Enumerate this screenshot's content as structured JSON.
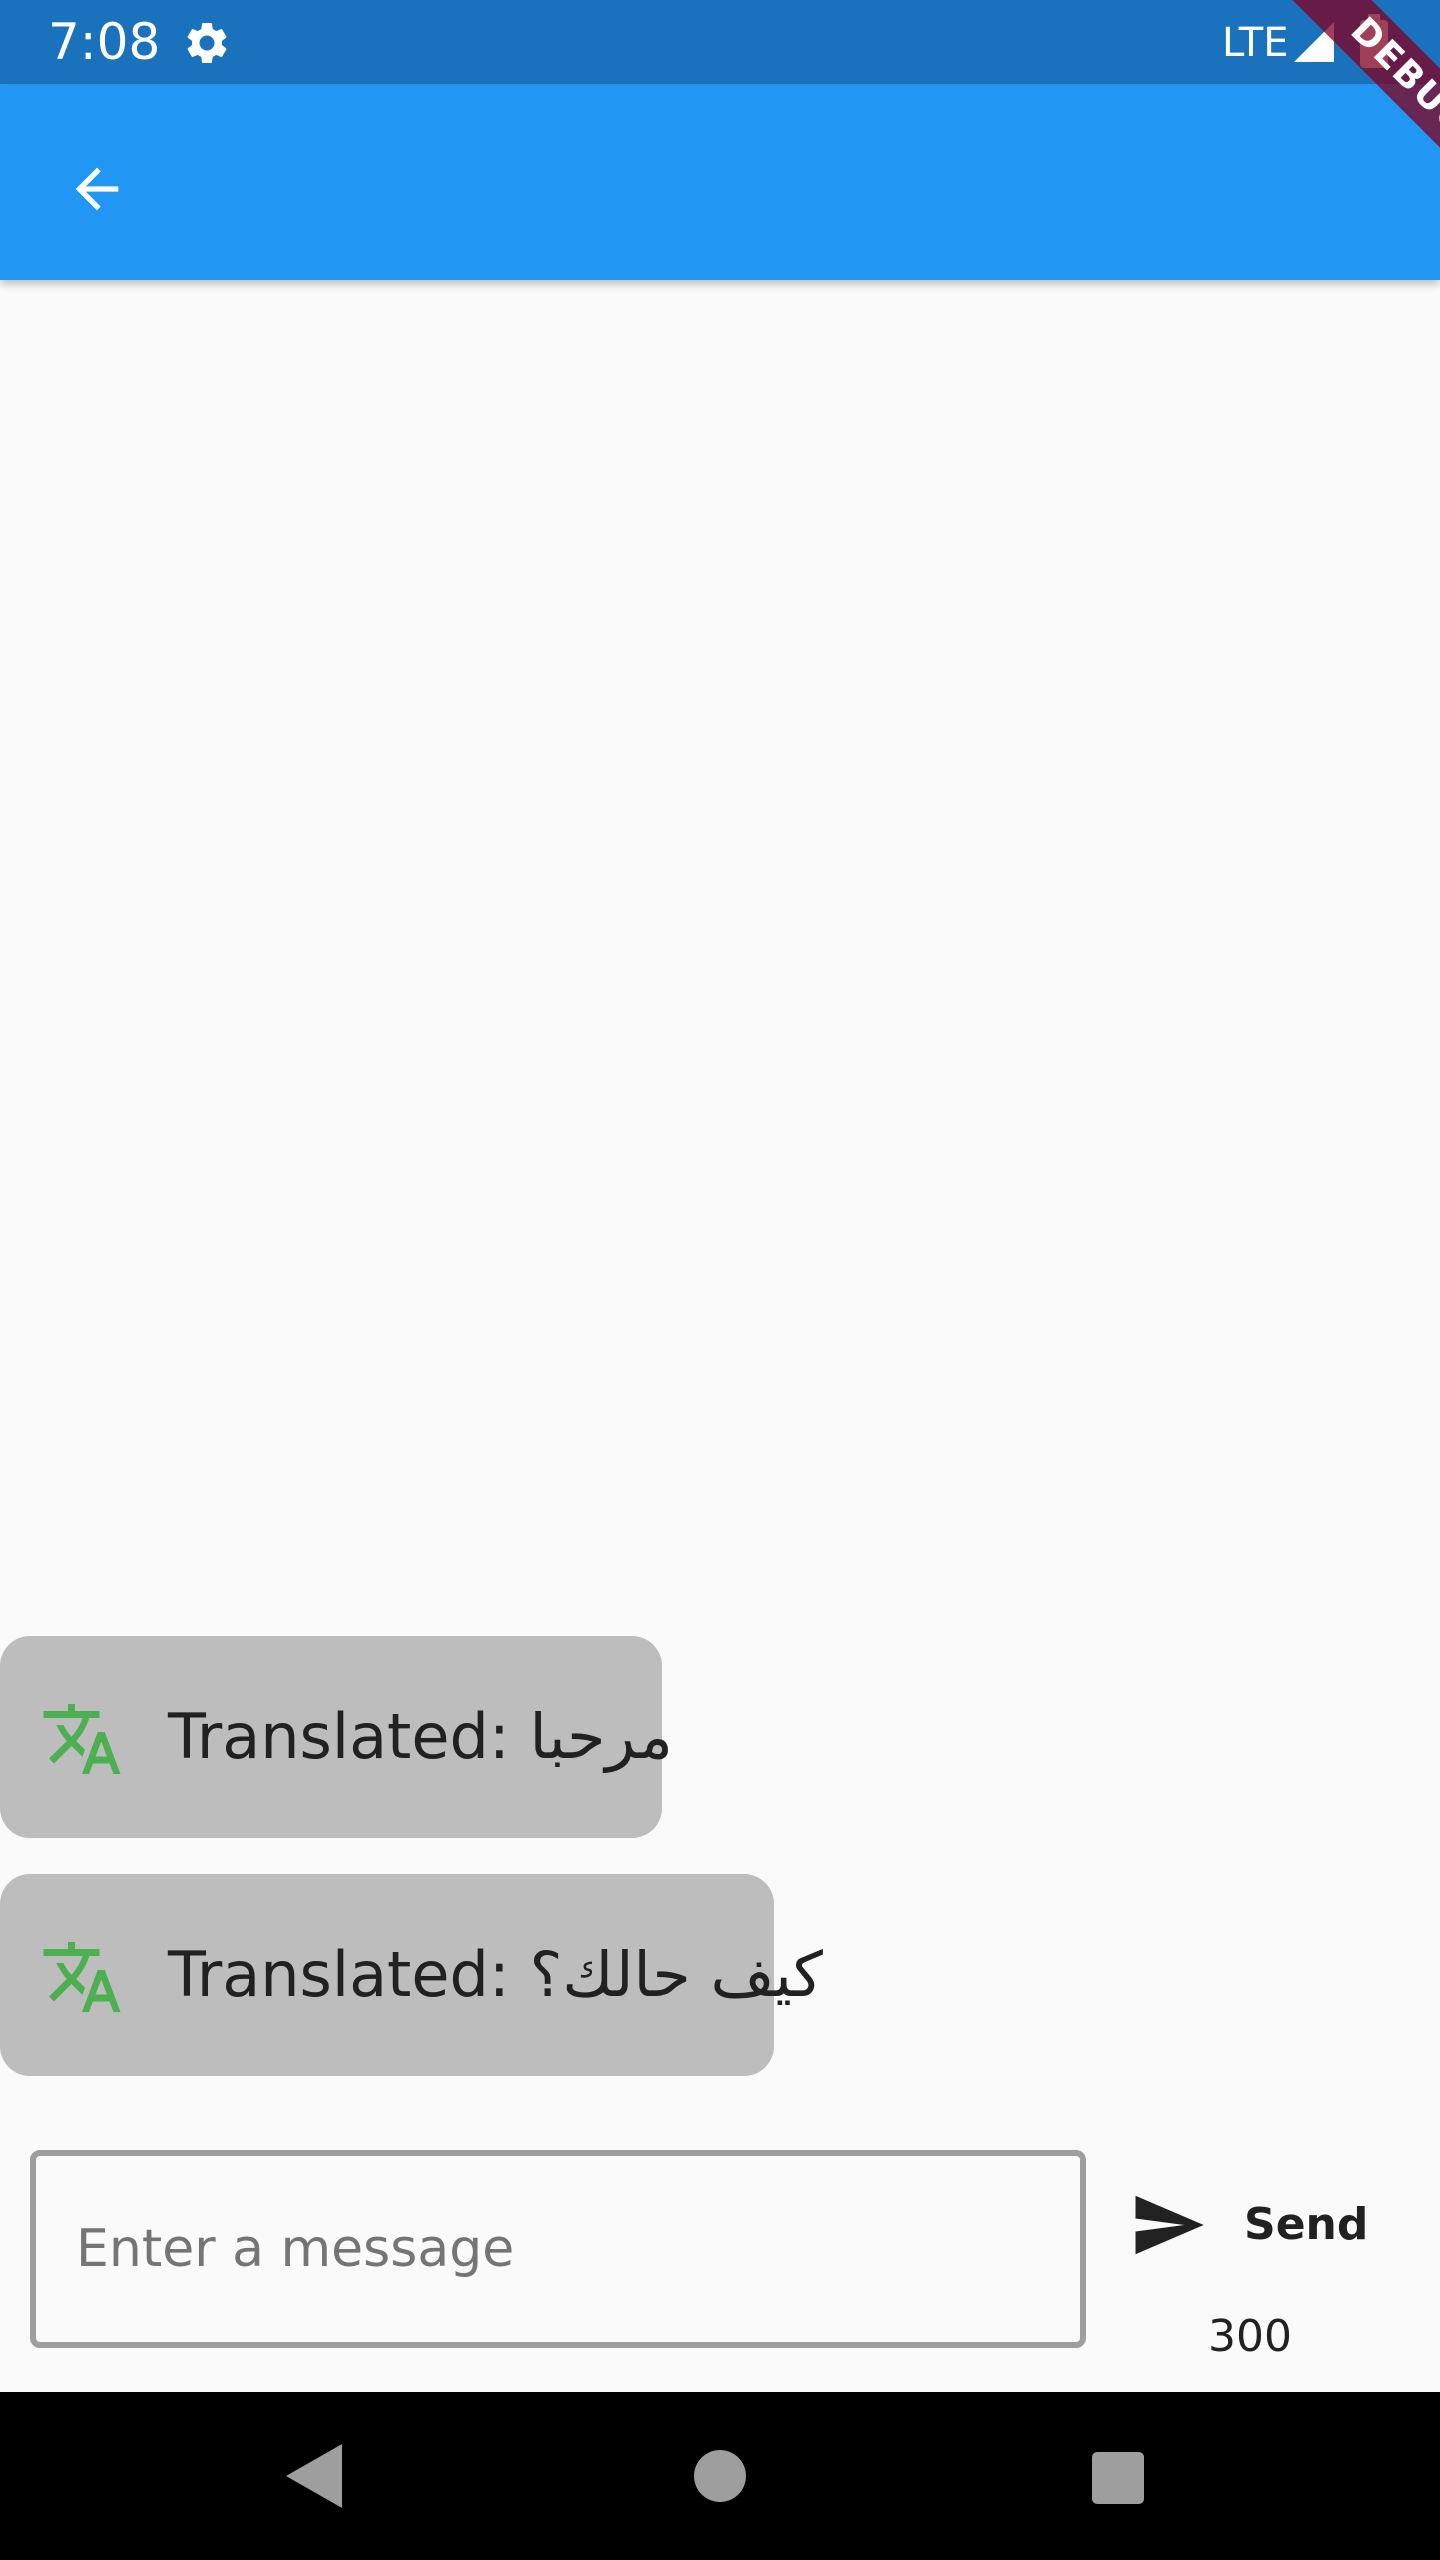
{
  "status_bar": {
    "time": "7:08",
    "network": "LTE",
    "icons": [
      "gear-icon",
      "signal-icon",
      "battery-icon"
    ]
  },
  "app_bar": {
    "back_icon": "arrow-back-icon",
    "color": "#2196f3"
  },
  "debug_banner": {
    "label": "DEBUG"
  },
  "messages": [
    {
      "icon": "translate-icon",
      "text": "Translated: مرحبا"
    },
    {
      "icon": "translate-icon",
      "text": "Translated: كيف حالك؟"
    }
  ],
  "composer": {
    "placeholder": "Enter a message",
    "value": "",
    "send_label": "Send",
    "counter": "300"
  },
  "colors": {
    "status_bar": "#1b72bc",
    "accent": "#2196f3",
    "bubble": "#bdbdbd",
    "translate_icon": "#4caf50"
  }
}
